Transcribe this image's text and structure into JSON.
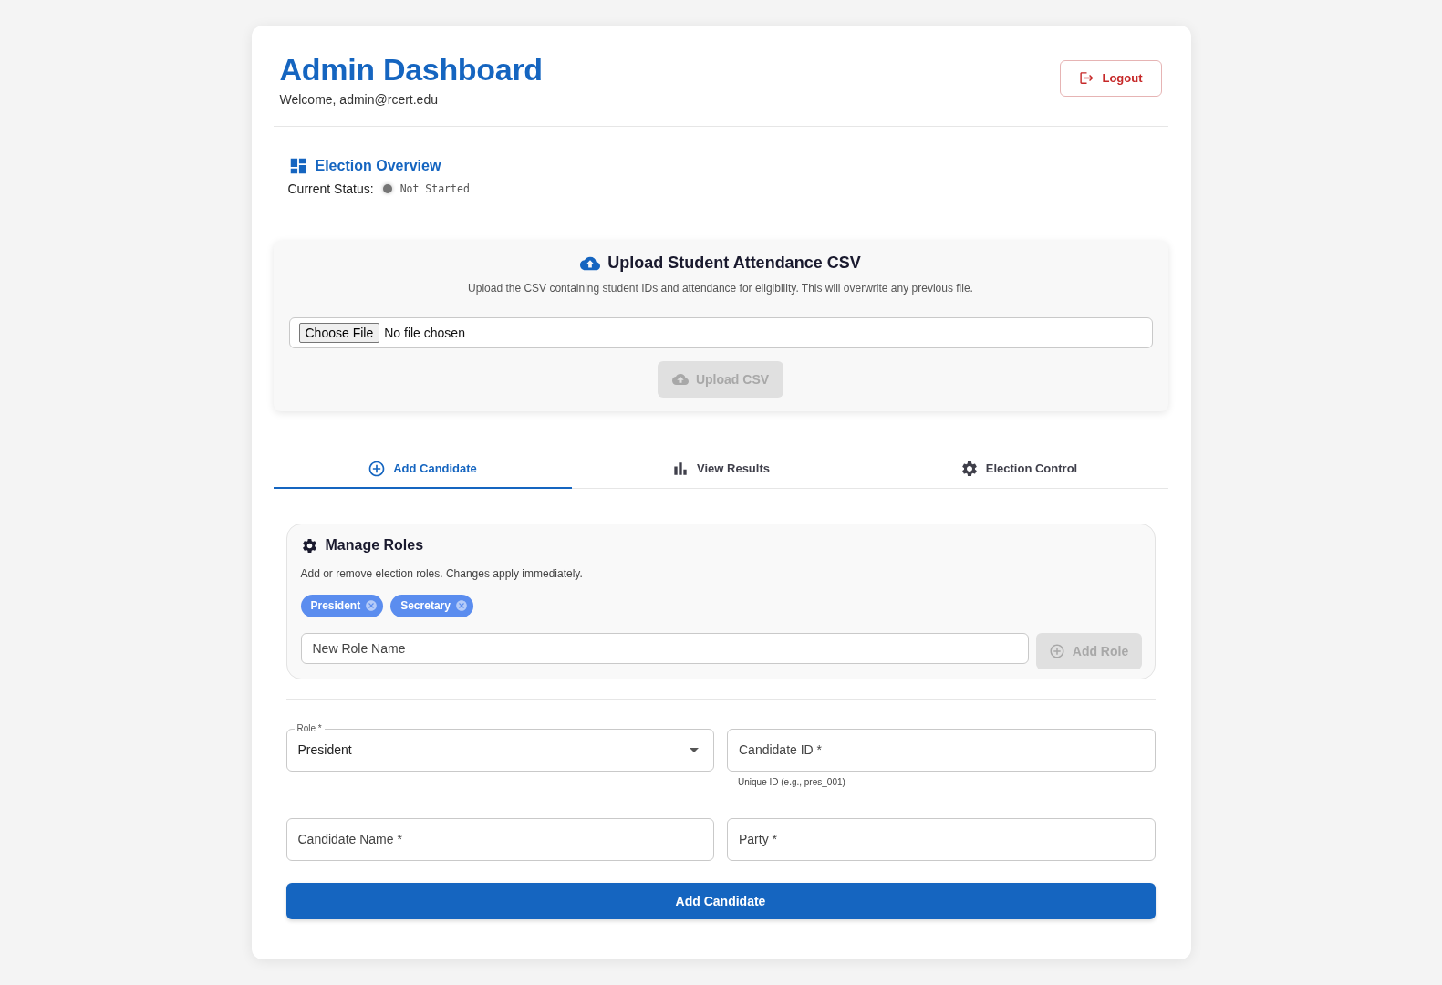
{
  "header": {
    "title": "Admin Dashboard",
    "welcome": "Welcome, admin@rcert.edu",
    "logout_button": "Logout"
  },
  "overview": {
    "title": "Election Overview",
    "status_label": "Current Status:",
    "status": "Not Started"
  },
  "upload": {
    "title": "Upload Student Attendance CSV",
    "description": "Upload the CSV containing student IDs and attendance for eligibility. This will overwrite any previous file.",
    "file_button": "Choose File",
    "file_status": "No file chosen",
    "upload_button": {
      "label": "Upload CSV",
      "disabled": true
    }
  },
  "tabs": [
    {
      "label": "Add Candidate",
      "selected": true
    },
    {
      "label": "View Results",
      "selected": false
    },
    {
      "label": "Election Control",
      "selected": false
    }
  ],
  "manage_roles": {
    "title": "Manage Roles",
    "description": "Add or remove election roles. Changes apply immediately.",
    "roles": [
      "President",
      "Secretary"
    ],
    "new_role_field": {
      "placeholder": "New Role Name"
    },
    "add_role_button": {
      "label": "Add Role",
      "disabled": true
    }
  },
  "candidate_form": {
    "fields": [
      {
        "kind": "select",
        "label": "Role *",
        "value": "President"
      },
      {
        "kind": "text",
        "placeholder": "Candidate ID *",
        "helper": "Unique ID (e.g., pres_001)"
      },
      {
        "kind": "text",
        "placeholder": "Candidate Name *"
      },
      {
        "kind": "text",
        "placeholder": "Party *"
      }
    ],
    "submit_button": "Add Candidate"
  }
}
